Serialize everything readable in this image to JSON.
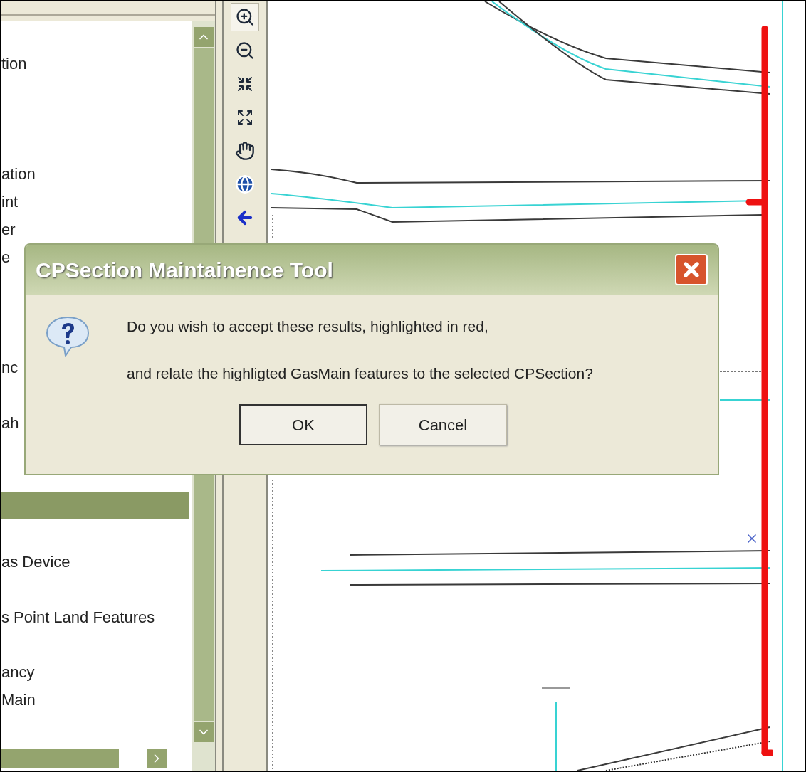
{
  "layer_list": {
    "items": [
      {
        "label": "tion",
        "selected": false
      },
      {
        "label": "ation",
        "selected": false
      },
      {
        "label": "int",
        "selected": false
      },
      {
        "label": "er",
        "selected": false
      },
      {
        "label": "e",
        "selected": false
      },
      {
        "label": "nc",
        "selected": false
      },
      {
        "label": "ah",
        "selected": false
      },
      {
        "selected": true
      },
      {
        "label": "as Device",
        "selected": false
      },
      {
        "label": "s Point Land Features",
        "selected": false
      },
      {
        "label": "ancy",
        "selected": false
      },
      {
        "label": "Main",
        "selected": false
      }
    ]
  },
  "toolbar": {
    "tools": [
      {
        "kind": "zoom-in",
        "selected": true
      },
      {
        "kind": "zoom-out",
        "selected": false
      },
      {
        "kind": "fixed-zoom-in",
        "selected": false
      },
      {
        "kind": "fixed-zoom-out",
        "selected": false
      },
      {
        "kind": "pan",
        "selected": false
      },
      {
        "kind": "full-extent",
        "selected": false
      },
      {
        "kind": "back",
        "selected": false
      }
    ]
  },
  "dialog": {
    "title": "CPSection Maintainence Tool",
    "message": [
      "Do you wish to accept these results, highlighted in red,",
      "and relate the highligted GasMain features to the selected CPSection?"
    ],
    "buttons": [
      {
        "label": "OK",
        "default": true
      },
      {
        "label": "Cancel",
        "default": false
      }
    ]
  }
}
